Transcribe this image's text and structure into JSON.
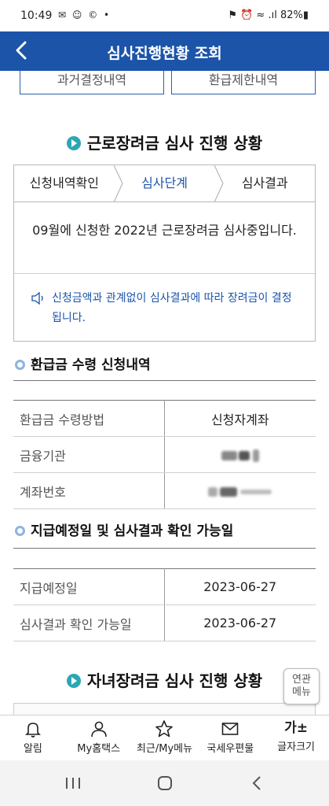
{
  "status_bar": {
    "time": "10:49",
    "notifications": "✉ ☺ © •",
    "right": "⚑ ⏰ ≈ .ıl 82%▮"
  },
  "app_bar": {
    "title": "심사진행현황 조회"
  },
  "top_buttons": {
    "past_decision": "과거결정내역",
    "refund_limit": "환급제한내역"
  },
  "work_incentive": {
    "title": "근로장려금 심사 진행 상황",
    "steps": [
      "신청내역확인",
      "심사단계",
      "심사결과"
    ],
    "active_step": 1,
    "message": "09월에 신청한 2022년 근로장려금 심사중입니다.",
    "note": "신청금액과 관계없이 심사결과에 따라 장려금이 결정됩니다."
  },
  "refund_receipt": {
    "title": "환급금 수령 신청내역",
    "rows": [
      {
        "label": "환급금 수령방법",
        "value": "신청자계좌"
      },
      {
        "label": "금융기관",
        "value": ""
      },
      {
        "label": "계좌번호",
        "value": ""
      }
    ]
  },
  "payment_schedule": {
    "title": "지급예정일 및 심사결과 확인 가능일",
    "rows": [
      {
        "label": "지급예정일",
        "value": "2023-06-27"
      },
      {
        "label": "심사결과 확인 가능일",
        "value": "2023-06-27"
      }
    ]
  },
  "child_incentive": {
    "title": "자녀장려금 심사 진행 상황"
  },
  "related_menu": {
    "line1": "연관",
    "line2": "메뉴"
  },
  "bottom_nav": [
    {
      "label": "알림",
      "icon": "bell-icon"
    },
    {
      "label": "My홈택스",
      "icon": "person-icon"
    },
    {
      "label": "최근/My메뉴",
      "icon": "star-icon"
    },
    {
      "label": "국세우편물",
      "icon": "mail-icon"
    },
    {
      "label": "글자크기",
      "icon": "font-size-icon",
      "glyph": "가±"
    }
  ],
  "colors": {
    "brand": "#1b54a9",
    "accent": "#2aa7b4",
    "sub_bullet": "#8db4e0"
  }
}
